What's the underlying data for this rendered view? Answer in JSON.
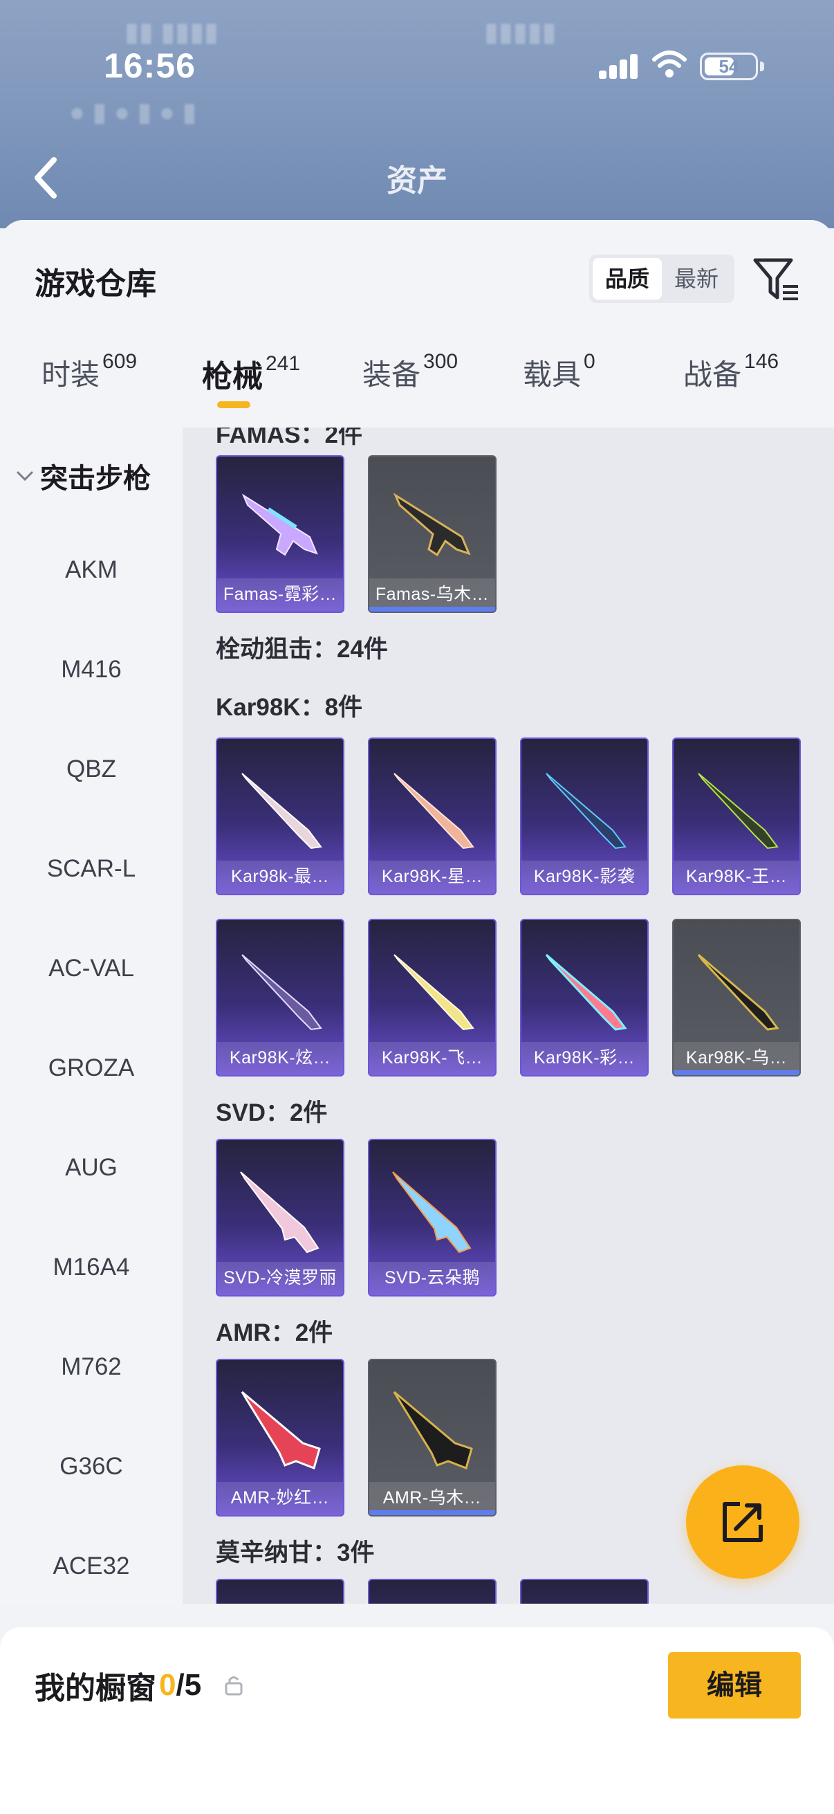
{
  "status_bar": {
    "time": "16:56",
    "battery": "54"
  },
  "nav": {
    "title": "资产"
  },
  "header": {
    "title": "游戏仓库",
    "sort_options": [
      "品质",
      "最新"
    ]
  },
  "tabs": [
    {
      "label": "时装",
      "count": "609"
    },
    {
      "label": "枪械",
      "count": "241"
    },
    {
      "label": "装备",
      "count": "300"
    },
    {
      "label": "载具",
      "count": "0"
    },
    {
      "label": "战备",
      "count": "146"
    }
  ],
  "sidebar": {
    "group": "突击步枪",
    "items": [
      "AKM",
      "M416",
      "QBZ",
      "SCAR-L",
      "AC-VAL",
      "GROZA",
      "AUG",
      "M16A4",
      "M762",
      "G36C",
      "ACE32"
    ]
  },
  "content": {
    "partial_section": "FAMAS：2件",
    "famas_items": [
      "Famas-霓彩…",
      "Famas-乌木…"
    ],
    "category_bolt": "栓动狙击：24件",
    "kar_section": "Kar98K：8件",
    "kar_items": [
      "Kar98k-最…",
      "Kar98K-星…",
      "Kar98K-影袭",
      "Kar98K-王…",
      "Kar98K-炫…",
      "Kar98K-飞…",
      "Kar98K-彩…",
      "Kar98K-乌…"
    ],
    "svd_section": "SVD：2件",
    "svd_items": [
      "SVD-冷漠罗丽",
      "SVD-云朵鹅"
    ],
    "amr_section": "AMR：2件",
    "amr_items": [
      "AMR-妙红…",
      "AMR-乌木…"
    ],
    "mosin_section": "莫辛纳甘：3件"
  },
  "bottom": {
    "showcase_label": "我的橱窗",
    "showcase_current": "0",
    "showcase_total": "/5",
    "edit_label": "编辑"
  },
  "colors": {
    "accent": "#f7b51f",
    "epic": "#6b57d8",
    "legend_bar": "#5e7ef0"
  }
}
